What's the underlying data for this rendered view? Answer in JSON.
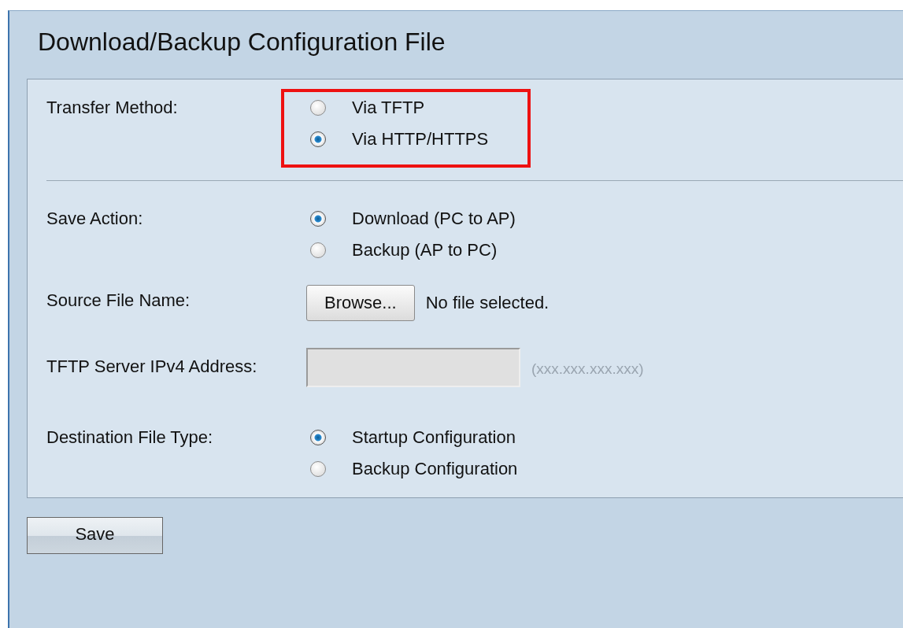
{
  "page": {
    "title": "Download/Backup Configuration File"
  },
  "sections": [
    {
      "label": "Transfer Method:",
      "kind": "radio",
      "highlighted": true,
      "options": [
        {
          "label": "Via TFTP",
          "selected": false
        },
        {
          "label": "Via HTTP/HTTPS",
          "selected": true
        }
      ]
    },
    {
      "label": "Save Action:",
      "kind": "radio",
      "highlighted": false,
      "options": [
        {
          "label": "Download (PC to AP)",
          "selected": true
        },
        {
          "label": "Backup (AP to PC)",
          "selected": false
        }
      ]
    },
    {
      "label": "Source File Name:",
      "kind": "file",
      "button": "Browse...",
      "status": "No file selected."
    },
    {
      "label": "TFTP Server IPv4 Address:",
      "kind": "text",
      "disabled": true,
      "hint": "(xxx.xxx.xxx.xxx)"
    },
    {
      "label": "Destination File Type:",
      "kind": "radio",
      "highlighted": false,
      "options": [
        {
          "label": "Startup Configuration",
          "selected": true
        },
        {
          "label": "Backup Configuration",
          "selected": false
        }
      ]
    }
  ],
  "buttons": [
    "Save"
  ]
}
